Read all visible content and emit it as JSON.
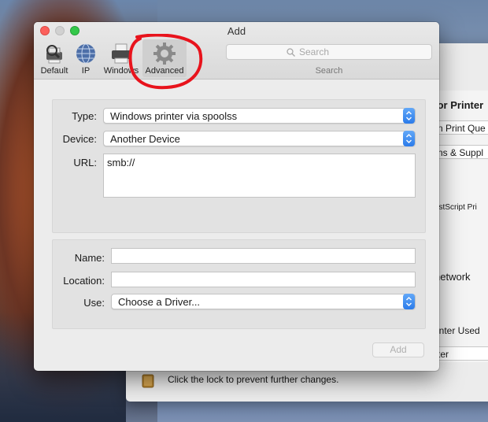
{
  "dialog": {
    "title": "Add",
    "toolbar": {
      "items": [
        {
          "label": "Default",
          "icon": "default-printer-icon"
        },
        {
          "label": "IP",
          "icon": "globe-icon"
        },
        {
          "label": "Windows",
          "icon": "windows-printer-icon"
        },
        {
          "label": "Advanced",
          "icon": "gear-icon",
          "selected": true
        }
      ],
      "search": {
        "placeholder": "Search",
        "caption": "Search"
      }
    },
    "form": {
      "type_label": "Type:",
      "type_value": "Windows printer via spoolss",
      "device_label": "Device:",
      "device_value": "Another Device",
      "url_label": "URL:",
      "url_value": "smb://",
      "name_label": "Name:",
      "name_value": "",
      "location_label": "Location:",
      "location_value": "",
      "use_label": "Use:",
      "use_value": "Choose a Driver..."
    },
    "add_button": "Add"
  },
  "background_window": {
    "heading": "lor Printer",
    "field1": "n Print Que",
    "field2": "ns & Suppl",
    "text1": "ostScript Pri",
    "text2": "network",
    "field3": "inter Used",
    "field4": "ter",
    "lock_text": "Click the lock to prevent further changes."
  },
  "colors": {
    "accent": "#2b7bea",
    "annotation": "#e8131c"
  }
}
